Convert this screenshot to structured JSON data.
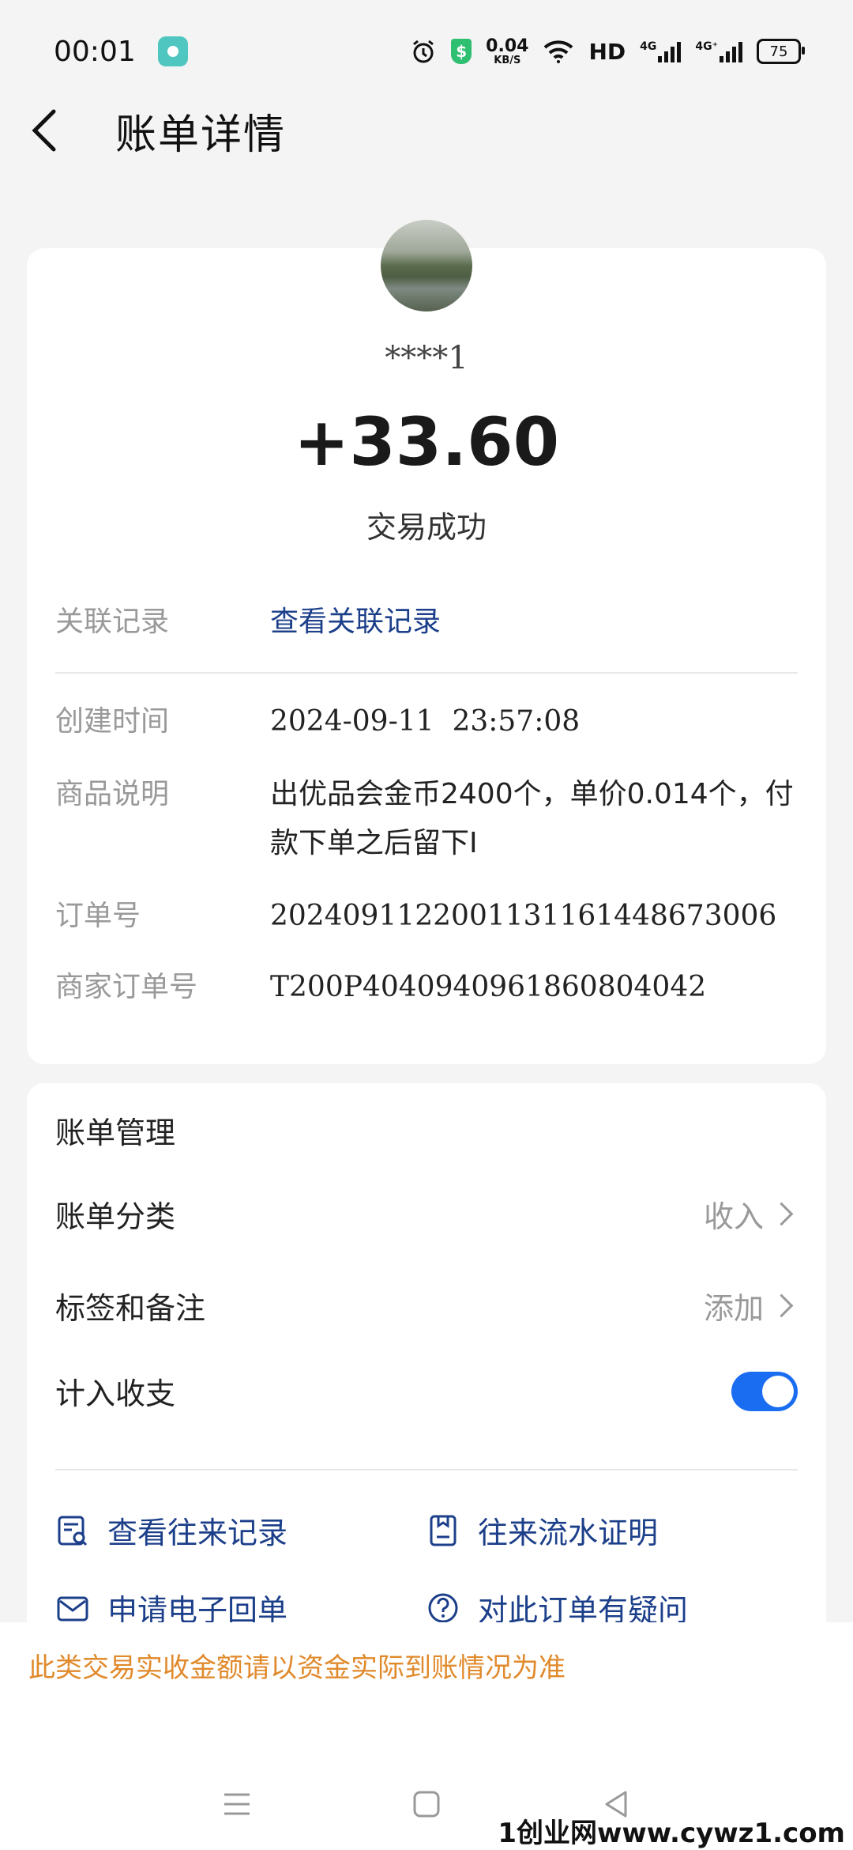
{
  "status_bar": {
    "time": "00:01",
    "net_speed": "0.04",
    "net_unit": "KB/S",
    "hd_label": "HD",
    "sim1": "4G",
    "sim2": "4G⁺",
    "battery": "75"
  },
  "header": {
    "title": "账单详情"
  },
  "transaction": {
    "payer": "****1",
    "amount": "+33.60",
    "status": "交易成功"
  },
  "details": {
    "related_label": "关联记录",
    "related_link": "查看关联记录",
    "created_label": "创建时间",
    "created_value": "2024-09-11  23:57:08",
    "desc_label": "商品说明",
    "desc_value_line1": "出优品会金币2400个，单价0.014个，付",
    "desc_value_line2": "款下单之后留下I",
    "order_label": "订单号",
    "order_value": "2024091122001131161448673006",
    "merchant_label": "商家订单号",
    "merchant_value": "T200P4040940961860804042"
  },
  "management": {
    "title": "账单管理",
    "category_label": "账单分类",
    "category_value": "收入",
    "tags_label": "标签和备注",
    "tags_value": "添加",
    "count_label": "计入收支",
    "count_enabled": true
  },
  "actions": {
    "history": "查看往来记录",
    "proof": "往来流水证明",
    "receipt": "申请电子回单",
    "question": "对此订单有疑问"
  },
  "notice": "此类交易实收金额请以资金实际到账情况为准",
  "watermark": "1创业网www.cywz1.com",
  "colors": {
    "accent": "#1a6df0",
    "link": "#1c3f8a",
    "notice": "#e18a2c"
  }
}
